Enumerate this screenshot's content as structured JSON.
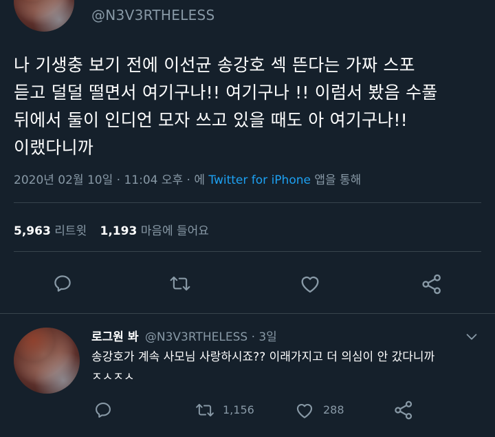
{
  "main_tweet": {
    "handle": "@N3V3RTHELESS",
    "text": "나 기생충 보기 전에 이선균 송강호 섹 뜬다는 가짜 스포\n듣고 덜덜 떨면서 여기구나!! 여기구나 !! 이럼서 봤음 수풀\n뒤에서 둘이 인디언 모자 쓰고 있을 때도 아 여기구나!!\n이랬다니까",
    "timestamp": "2020년 02월 10일 · 11:04 오후 · 에",
    "source": "Twitter for iPhone",
    "source_suffix": "앱을 통해",
    "retweets_count": "5,963",
    "retweets_label": "리트윗",
    "likes_count": "1,193",
    "likes_label": "마음에 들어요"
  },
  "reply": {
    "display_name": "로그원 봐",
    "handle": "@N3V3RTHELESS",
    "time": "· 3일",
    "text": "송강호가 계속 사모님 사랑하시죠?? 이래가지고 더 의심이 안 갔다니까\nㅈㅅㅈㅅ",
    "retweet_count": "1,156",
    "like_count": "288"
  },
  "icons": {
    "reply": "reply-icon",
    "retweet": "retweet-icon",
    "like": "heart-icon",
    "share": "share-icon",
    "more": "chevron-down-icon"
  },
  "colors": {
    "background": "#15202b",
    "text": "#ffffff",
    "muted": "#8899a6",
    "link": "#1da1f2",
    "divider": "#38444d"
  }
}
